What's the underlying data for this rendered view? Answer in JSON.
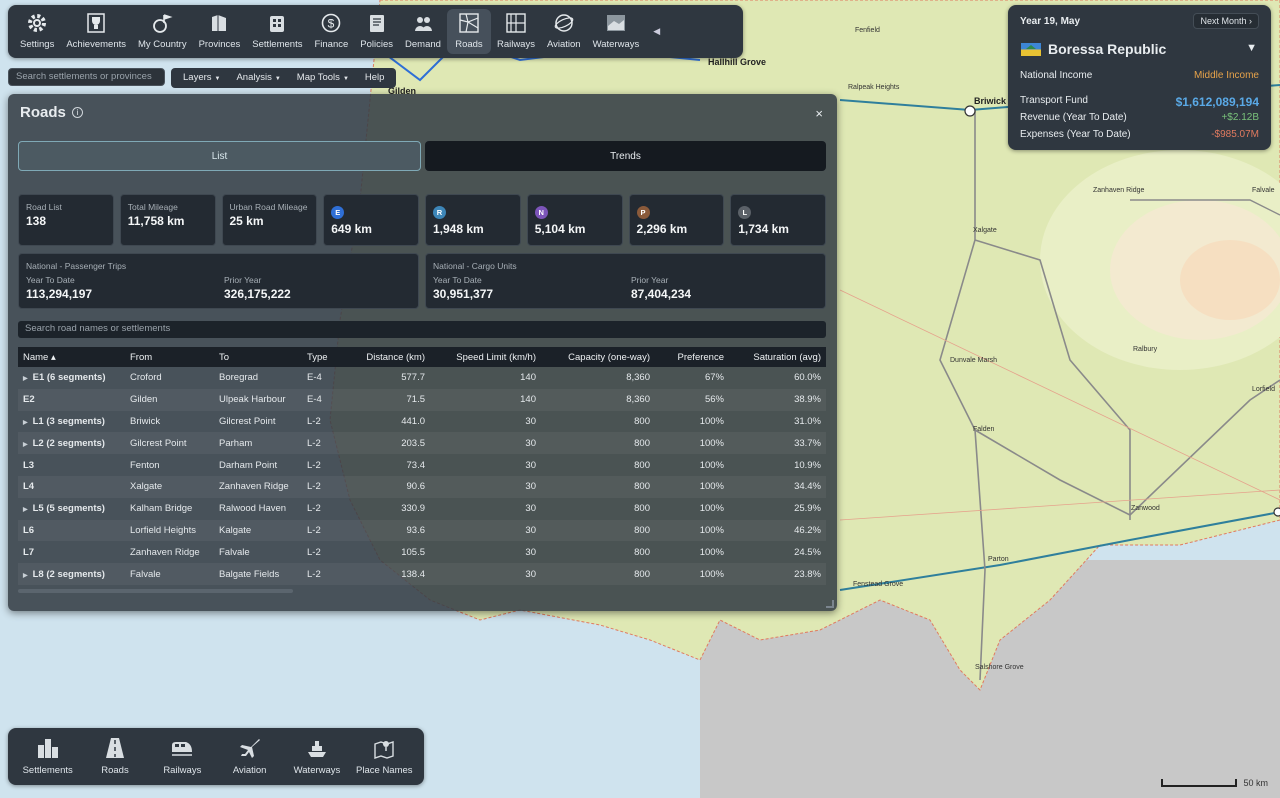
{
  "toolbar": {
    "items": [
      {
        "label": "Settings",
        "icon": "gear-icon"
      },
      {
        "label": "Achievements",
        "icon": "trophy-icon"
      },
      {
        "label": "My Country",
        "icon": "flag-icon"
      },
      {
        "label": "Provinces",
        "icon": "map-icon"
      },
      {
        "label": "Settlements",
        "icon": "buildings-icon"
      },
      {
        "label": "Finance",
        "icon": "dollar-icon"
      },
      {
        "label": "Policies",
        "icon": "scroll-icon"
      },
      {
        "label": "Demand",
        "icon": "people-icon"
      },
      {
        "label": "Roads",
        "icon": "road-network-icon"
      },
      {
        "label": "Railways",
        "icon": "railway-map-icon"
      },
      {
        "label": "Aviation",
        "icon": "globe-plane-icon"
      },
      {
        "label": "Waterways",
        "icon": "ship-icon"
      }
    ],
    "active": "Roads",
    "collapse_glyph": "◀"
  },
  "search": {
    "placeholder": "Search settlements or provinces"
  },
  "menus": [
    {
      "label": "Layers",
      "has_caret": true
    },
    {
      "label": "Analysis",
      "has_caret": true
    },
    {
      "label": "Map Tools",
      "has_caret": true
    },
    {
      "label": "Help",
      "has_caret": false
    }
  ],
  "roads_panel": {
    "title": "Roads",
    "close_glyph": "×",
    "tabs": [
      {
        "label": "List",
        "active": true
      },
      {
        "label": "Trends",
        "active": false
      }
    ],
    "stats": [
      {
        "label": "Road List",
        "value": "138"
      },
      {
        "label": "Total Mileage",
        "value": "11,758 km"
      },
      {
        "label": "Urban Road Mileage",
        "value": "25 km"
      },
      {
        "badge": "E",
        "badge_color": "#2f6fd6",
        "value": "649 km"
      },
      {
        "badge": "R",
        "badge_color": "#3d86b8",
        "value": "1,948 km"
      },
      {
        "badge": "N",
        "badge_color": "#7c55b9",
        "value": "5,104 km"
      },
      {
        "badge": "P",
        "badge_color": "#8a5a3a",
        "value": "2,296 km"
      },
      {
        "badge": "L",
        "badge_color": "#5b6168",
        "value": "1,734 km"
      }
    ],
    "passenger": {
      "heading": "National - Passenger Trips",
      "ytd_label": "Year To Date",
      "ytd_value": "113,294,197",
      "prior_label": "Prior Year",
      "prior_value": "326,175,222"
    },
    "cargo": {
      "heading": "National - Cargo Units",
      "ytd_label": "Year To Date",
      "ytd_value": "30,951,377",
      "prior_label": "Prior Year",
      "prior_value": "87,404,234"
    },
    "road_search_placeholder": "Search road names or settlements",
    "columns": [
      "Name ▴",
      "From",
      "To",
      "Type",
      "Distance (km)",
      "Speed Limit (km/h)",
      "Capacity (one-way)",
      "Preference",
      "Saturation (avg)"
    ],
    "rows": [
      {
        "expandable": true,
        "name": "E1",
        "segments": "(6 segments)",
        "from": "Croford",
        "to": "Boregrad",
        "type": "E-4",
        "distance": "577.7",
        "speed": "140",
        "capacity": "8,360",
        "preference": "67%",
        "saturation": "60.0%"
      },
      {
        "expandable": false,
        "name": "E2",
        "segments": "",
        "from": "Gilden",
        "to": "Ulpeak Harbour",
        "type": "E-4",
        "distance": "71.5",
        "speed": "140",
        "capacity": "8,360",
        "preference": "56%",
        "saturation": "38.9%"
      },
      {
        "expandable": true,
        "name": "L1",
        "segments": "(3 segments)",
        "from": "Briwick",
        "to": "Gilcrest Point",
        "type": "L-2",
        "distance": "441.0",
        "speed": "30",
        "capacity": "800",
        "preference": "100%",
        "saturation": "31.0%"
      },
      {
        "expandable": true,
        "name": "L2",
        "segments": "(2 segments)",
        "from": "Gilcrest Point",
        "to": "Parham",
        "type": "L-2",
        "distance": "203.5",
        "speed": "30",
        "capacity": "800",
        "preference": "100%",
        "saturation": "33.7%"
      },
      {
        "expandable": false,
        "name": "L3",
        "segments": "",
        "from": "Fenton",
        "to": "Darham Point",
        "type": "L-2",
        "distance": "73.4",
        "speed": "30",
        "capacity": "800",
        "preference": "100%",
        "saturation": "10.9%"
      },
      {
        "expandable": false,
        "name": "L4",
        "segments": "",
        "from": "Xalgate",
        "to": "Zanhaven Ridge",
        "type": "L-2",
        "distance": "90.6",
        "speed": "30",
        "capacity": "800",
        "preference": "100%",
        "saturation": "34.4%"
      },
      {
        "expandable": true,
        "name": "L5",
        "segments": "(5 segments)",
        "from": "Kalham Bridge",
        "to": "Ralwood Haven",
        "type": "L-2",
        "distance": "330.9",
        "speed": "30",
        "capacity": "800",
        "preference": "100%",
        "saturation": "25.9%"
      },
      {
        "expandable": false,
        "name": "L6",
        "segments": "",
        "from": "Lorfield Heights",
        "to": "Kalgate",
        "type": "L-2",
        "distance": "93.6",
        "speed": "30",
        "capacity": "800",
        "preference": "100%",
        "saturation": "46.2%"
      },
      {
        "expandable": false,
        "name": "L7",
        "segments": "",
        "from": "Zanhaven Ridge",
        "to": "Falvale",
        "type": "L-2",
        "distance": "105.5",
        "speed": "30",
        "capacity": "800",
        "preference": "100%",
        "saturation": "24.5%"
      },
      {
        "expandable": true,
        "name": "L8",
        "segments": "(2 segments)",
        "from": "Falvale",
        "to": "Balgate Fields",
        "type": "L-2",
        "distance": "138.4",
        "speed": "30",
        "capacity": "800",
        "preference": "100%",
        "saturation": "23.8%"
      }
    ]
  },
  "country": {
    "date": "Year 19, May",
    "next_month": "Next Month ›",
    "name": "Boressa Republic",
    "dropdown_glyph": "▼",
    "income_label": "National Income",
    "income_value": "Middle Income",
    "income_color": "#e6a24a",
    "fund_label": "Transport Fund",
    "fund_value": "$1,612,089,194",
    "fund_color": "#5aa9e6",
    "revenue_label": "Revenue (Year To Date)",
    "revenue_value": "+$2.12B",
    "revenue_color": "#79c27a",
    "expenses_label": "Expenses (Year To Date)",
    "expenses_value": "-$985.07M",
    "expenses_color": "#e07a5f"
  },
  "bottombar": {
    "items": [
      {
        "label": "Settlements",
        "icon": "city-icon"
      },
      {
        "label": "Roads",
        "icon": "road-icon"
      },
      {
        "label": "Railways",
        "icon": "train-icon"
      },
      {
        "label": "Aviation",
        "icon": "airplane-icon"
      },
      {
        "label": "Waterways",
        "icon": "ship-icon"
      },
      {
        "label": "Place Names",
        "icon": "map-pin-icon"
      }
    ]
  },
  "map": {
    "labels": [
      "Fenfield",
      "Hallhill Grove",
      "Gilden",
      "Ralpeak Heights",
      "Briwick",
      "Zanhaven Ridge",
      "Falvale",
      "Xalgate",
      "Dunvale Marsh",
      "Ralbury",
      "Lorfield",
      "Falden",
      "Zanwood",
      "Parton",
      "Fenstead Grove",
      "Salshore Grove"
    ],
    "scale_label": "50 km"
  }
}
